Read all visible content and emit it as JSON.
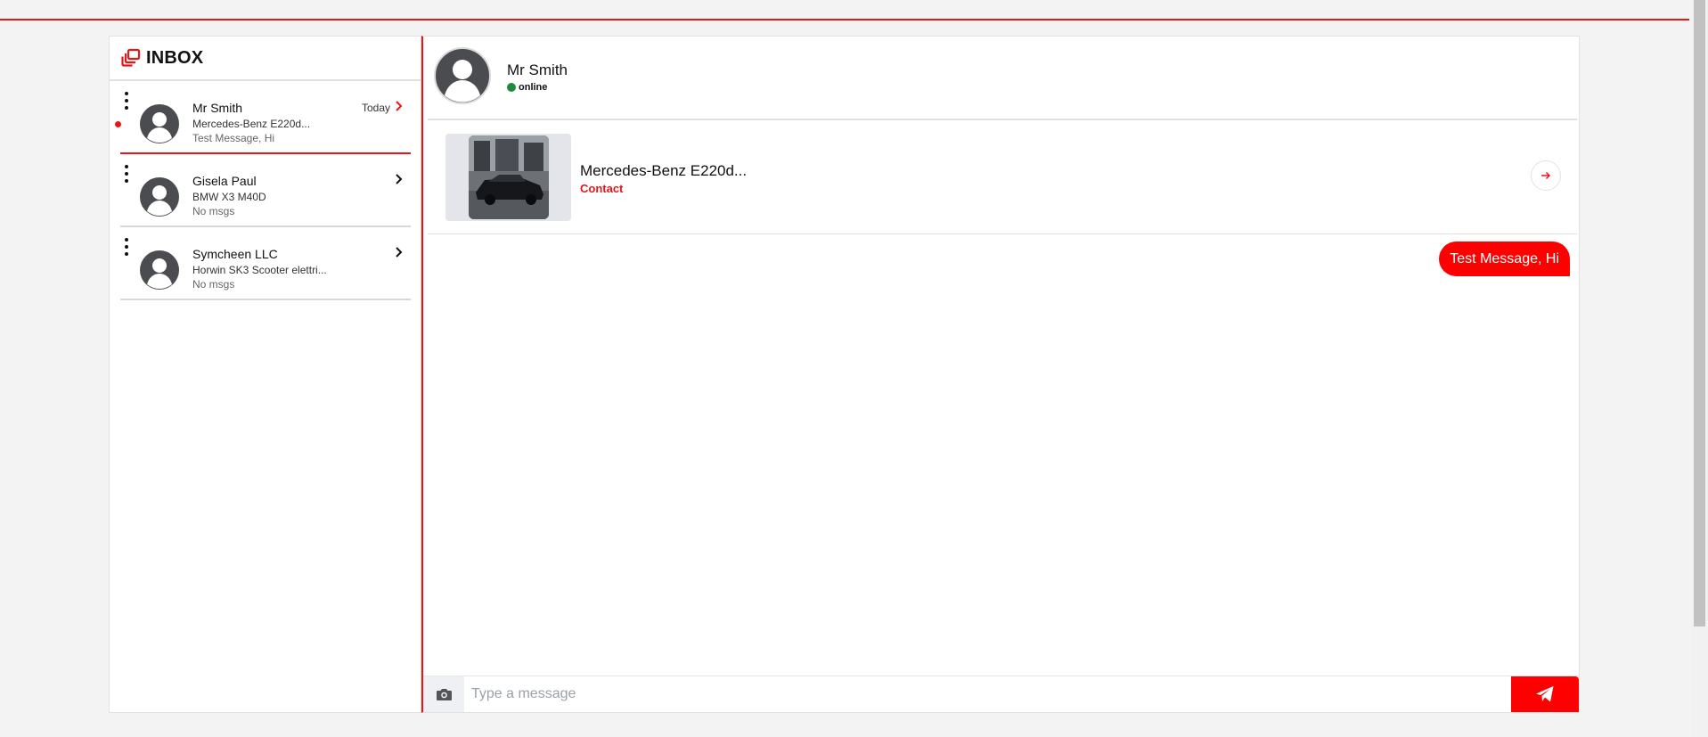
{
  "inbox": {
    "title": "INBOX",
    "conversations": [
      {
        "name": "Mr Smith",
        "subject": "Mercedes-Benz E220d...",
        "preview": "Test Message, Hi",
        "date": "Today",
        "unread": true,
        "active": true
      },
      {
        "name": "Gisela Paul",
        "subject": "BMW X3 M40D",
        "preview": "No msgs",
        "date": "",
        "unread": false,
        "active": false
      },
      {
        "name": "Symcheen LLC",
        "subject": "Horwin SK3 Scooter elettri...",
        "preview": "No msgs",
        "date": "",
        "unread": false,
        "active": false
      }
    ]
  },
  "chat": {
    "contact_name": "Mr Smith",
    "status": "online",
    "listing": {
      "title": "Mercedes-Benz E220d...",
      "link_label": "Contact"
    },
    "messages": [
      {
        "text": "Test Message, Hi",
        "direction": "outgoing"
      }
    ],
    "composer": {
      "placeholder": "Type a message"
    }
  },
  "colors": {
    "accent": "#e8161b",
    "online": "#1c8b3a",
    "bubble": "#ff0000"
  },
  "icons": [
    "inbox-icon",
    "kebab-menu-icon",
    "avatar-icon",
    "chevron-right-icon",
    "arrow-right-icon",
    "camera-icon",
    "send-icon"
  ]
}
